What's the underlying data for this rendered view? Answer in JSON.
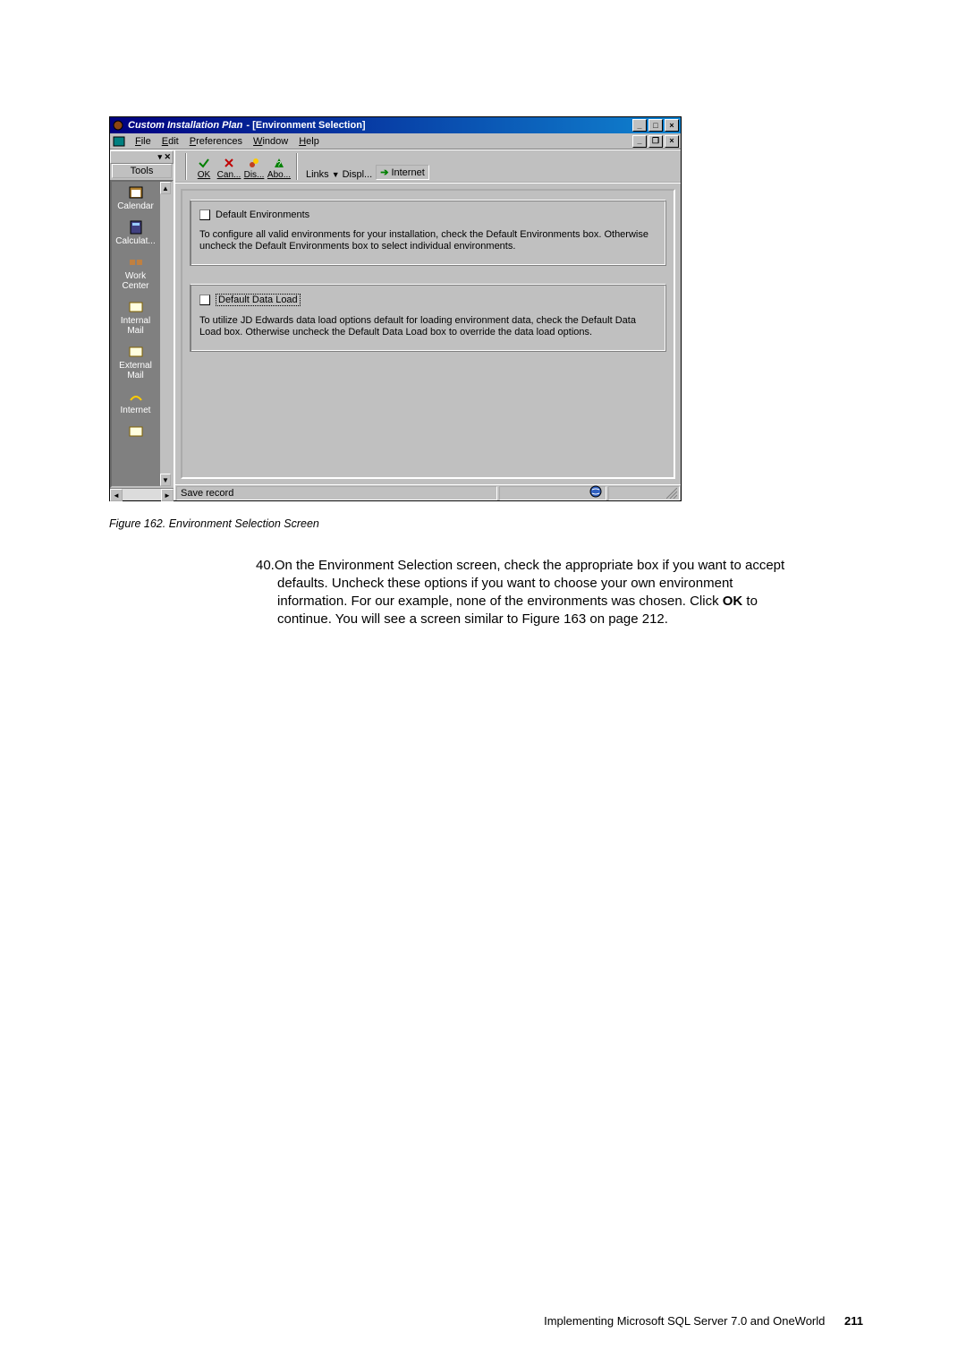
{
  "app": {
    "title_italic": "Custom Installation Plan",
    "title_suffix": "  - [Environment Selection]"
  },
  "menu": {
    "file": "File",
    "edit": "Edit",
    "preferences": "Preferences",
    "window": "Window",
    "help": "Help"
  },
  "sidebar": {
    "header": "Tools",
    "items": {
      "calendar": "Calendar",
      "calculat": "Calculat...",
      "work1": "Work",
      "work2": "Center",
      "imail1": "Internal",
      "imail2": "Mail",
      "emaill1": "External",
      "emaill2": "Mail",
      "internet": "Internet"
    }
  },
  "toolbar": {
    "ok": "OK",
    "can": "Can...",
    "dis": "Dis...",
    "abo": "Abo...",
    "links": "Links",
    "displ": "Displ...",
    "internet": "Internet"
  },
  "groups": {
    "env": {
      "label": "Default Environments",
      "desc": "To configure all valid environments for your installation, check the Default Environments box.  Otherwise uncheck the Default Environments box to select individual environments."
    },
    "data": {
      "label": "Default Data Load",
      "desc": "To utilize JD Edwards data load options default for loading environment data, check the Default Data Load box.  Otherwise uncheck the Default Data Load box to override the data load options."
    }
  },
  "status": "Save record",
  "figure_caption": "Figure 162.  Environment Selection Screen",
  "body_step_num": "40.",
  "body_text": "On the Environment Selection screen, check the appropriate box if you want to accept defaults. Uncheck these options if you want to choose your own environment information. For our example, none of the environments was chosen. Click ",
  "body_bold": "OK",
  "body_after": " to continue. You will see a screen similar to Figure 163 on page 212.",
  "footer_text": "Implementing Microsoft SQL Server 7.0 and OneWorld",
  "page_number": "211"
}
